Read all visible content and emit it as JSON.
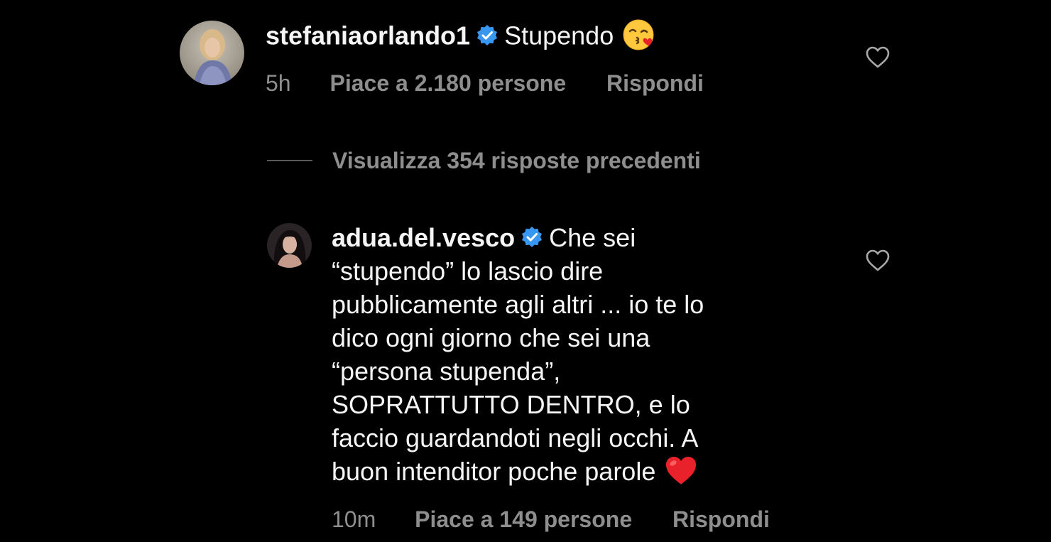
{
  "comment": {
    "username": "stefaniaorlando1",
    "text": "Stupendo",
    "emoji": "kissing-face-with-heart-emoji",
    "time": "5h",
    "likes": "Piace a 2.180 persone",
    "reply_label": "Rispondi"
  },
  "view_replies": {
    "label": "Visualizza 354 risposte precedenti"
  },
  "reply": {
    "username": "adua.del.vesco",
    "lines": [
      "Che sei",
      "“stupendo” lo lascio dire",
      "pubblicamente agli altri ... io te lo",
      "dico ogni giorno che sei una",
      "“persona stupenda”,",
      "SOPRATTUTTO DENTRO, e lo",
      "faccio guardandoti negli occhi. A",
      "buon intenditor poche parole"
    ],
    "emoji": "red-heart-emoji",
    "time": "10m",
    "likes": "Piace a 149 persone",
    "reply_label": "Rispondi"
  },
  "colors": {
    "background": "#000000",
    "text": "#f5f5f5",
    "secondary": "#8e8e8e",
    "verified": "#3897f0",
    "heart_emoji": "#e8212b"
  }
}
